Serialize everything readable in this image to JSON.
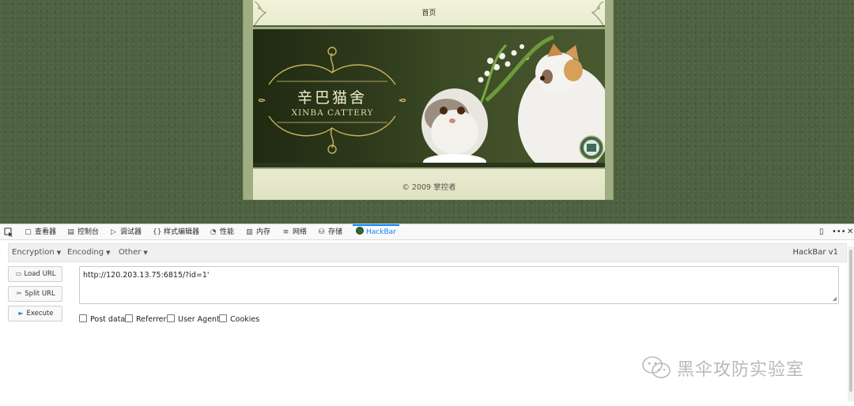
{
  "webpage": {
    "nav_home": "首页",
    "banner_title_cn": "辛巴猫舍",
    "banner_title_en": "XINBA CATTERY",
    "footer": "© 2009 掌控者"
  },
  "devtools": {
    "tabs": [
      {
        "label": "查看器",
        "icon": "inspector-icon"
      },
      {
        "label": "控制台",
        "icon": "console-icon"
      },
      {
        "label": "调试器",
        "icon": "debugger-icon"
      },
      {
        "label": "样式编辑器",
        "icon": "style-editor-icon"
      },
      {
        "label": "性能",
        "icon": "performance-icon"
      },
      {
        "label": "内存",
        "icon": "memory-icon"
      },
      {
        "label": "网络",
        "icon": "network-icon"
      },
      {
        "label": "存储",
        "icon": "storage-icon"
      },
      {
        "label": "HackBar",
        "icon": "hackbar-icon"
      }
    ],
    "active_tab": "HackBar",
    "accent_color": "#0a84ff"
  },
  "hackbar": {
    "menus": [
      "Encryption",
      "Encoding",
      "Other"
    ],
    "version": "HackBar v1",
    "buttons": {
      "load_url": "Load URL",
      "split_url": "Split URL",
      "execute": "Execute"
    },
    "url_value": "http://120.203.13.75:6815/?id=1'",
    "options": [
      "Post data",
      "Referrer",
      "User Agent",
      "Cookies"
    ]
  },
  "watermark": {
    "text": "黑伞攻防实验室",
    "icon": "wechat-icon"
  }
}
